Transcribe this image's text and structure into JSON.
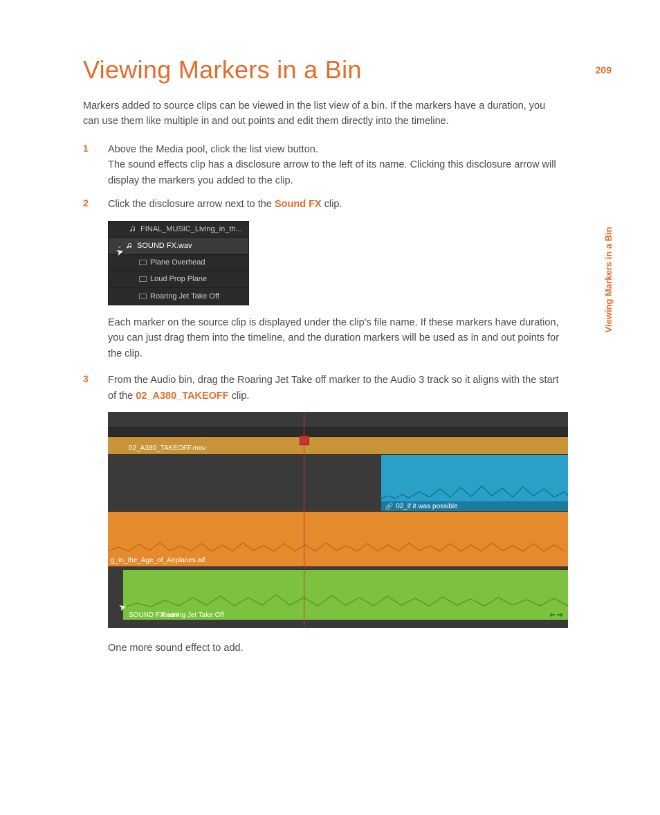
{
  "page_number": "209",
  "side_title": "Viewing Markers in a Bin",
  "heading": "Viewing Markers in a Bin",
  "intro": "Markers added to source clips can be viewed in the list view of a bin. If the markers have a duration, you can use them like multiple in and out points and edit them directly into the timeline.",
  "steps": {
    "s1": {
      "num": "1",
      "line1": "Above the Media pool, click the list view button.",
      "line2": "The sound effects clip has a disclosure arrow to the left of its name. Clicking this disclosure arrow will display the markers you added to the clip."
    },
    "s2": {
      "num": "2",
      "prefix": "Click the disclosure arrow next to the ",
      "bold": "Sound FX",
      "suffix": " clip."
    },
    "s3": {
      "num": "3",
      "prefix": "From the Audio bin, drag the Roaring Jet Take off marker to the Audio 3 track so it aligns with the start of the ",
      "bold": "02_A380_TAKEOFF",
      "suffix": " clip."
    }
  },
  "after_bin": "Each marker on the source clip is displayed under the clip's file name. If these markers have duration, you can just drag them into the timeline, and the duration markers will be used as in and out points for the clip.",
  "after_timeline": "One more sound effect to add.",
  "bin": {
    "r0": "FINAL_MUSIC_Living_in_th...",
    "r1": "SOUND FX.wav",
    "r2": "Plane Overhead",
    "r3": "Loud Prop Plane",
    "r4": "Roaring Jet Take Off"
  },
  "timeline": {
    "video1_label": "02_A380_TAKEOFF.mov",
    "blue_label": "02_if it was possible",
    "orange_label": "g_in_the_Age_of_Airplanes.aif",
    "green_left": "SOUND FX.wav",
    "green_mid": "Roaring Jet Take Off"
  }
}
